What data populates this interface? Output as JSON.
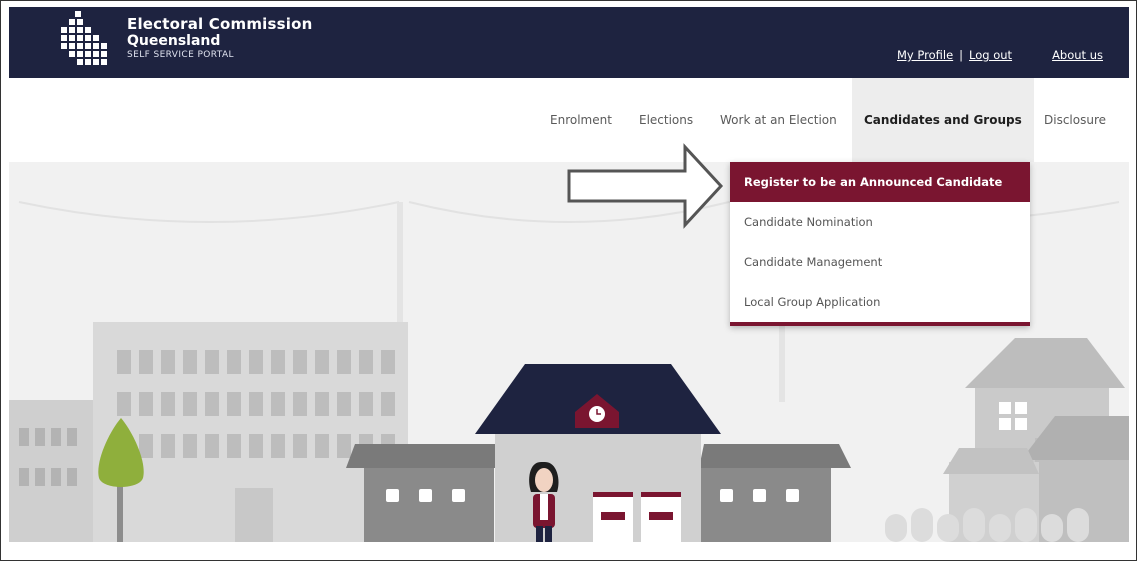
{
  "header": {
    "brand_line1": "Electoral Commission",
    "brand_line2": "Queensland",
    "brand_line3": "SELF SERVICE PORTAL",
    "my_profile": "My Profile",
    "separator": "|",
    "log_out": "Log out",
    "about_us": "About us",
    "bg_color": "#1e2340"
  },
  "nav": {
    "items": [
      {
        "label": "Enrolment"
      },
      {
        "label": "Elections"
      },
      {
        "label": "Work at an Election"
      },
      {
        "label": "Candidates and Groups",
        "active": true
      },
      {
        "label": "Disclosure"
      }
    ]
  },
  "dropdown": {
    "items": [
      {
        "label": "Register to be an Announced Candidate",
        "highlighted": true
      },
      {
        "label": "Candidate Nomination"
      },
      {
        "label": "Candidate Management"
      },
      {
        "label": "Local Group Application"
      }
    ],
    "accent_color": "#7a1530"
  },
  "annotation": {
    "icon": "right-arrow-icon"
  }
}
